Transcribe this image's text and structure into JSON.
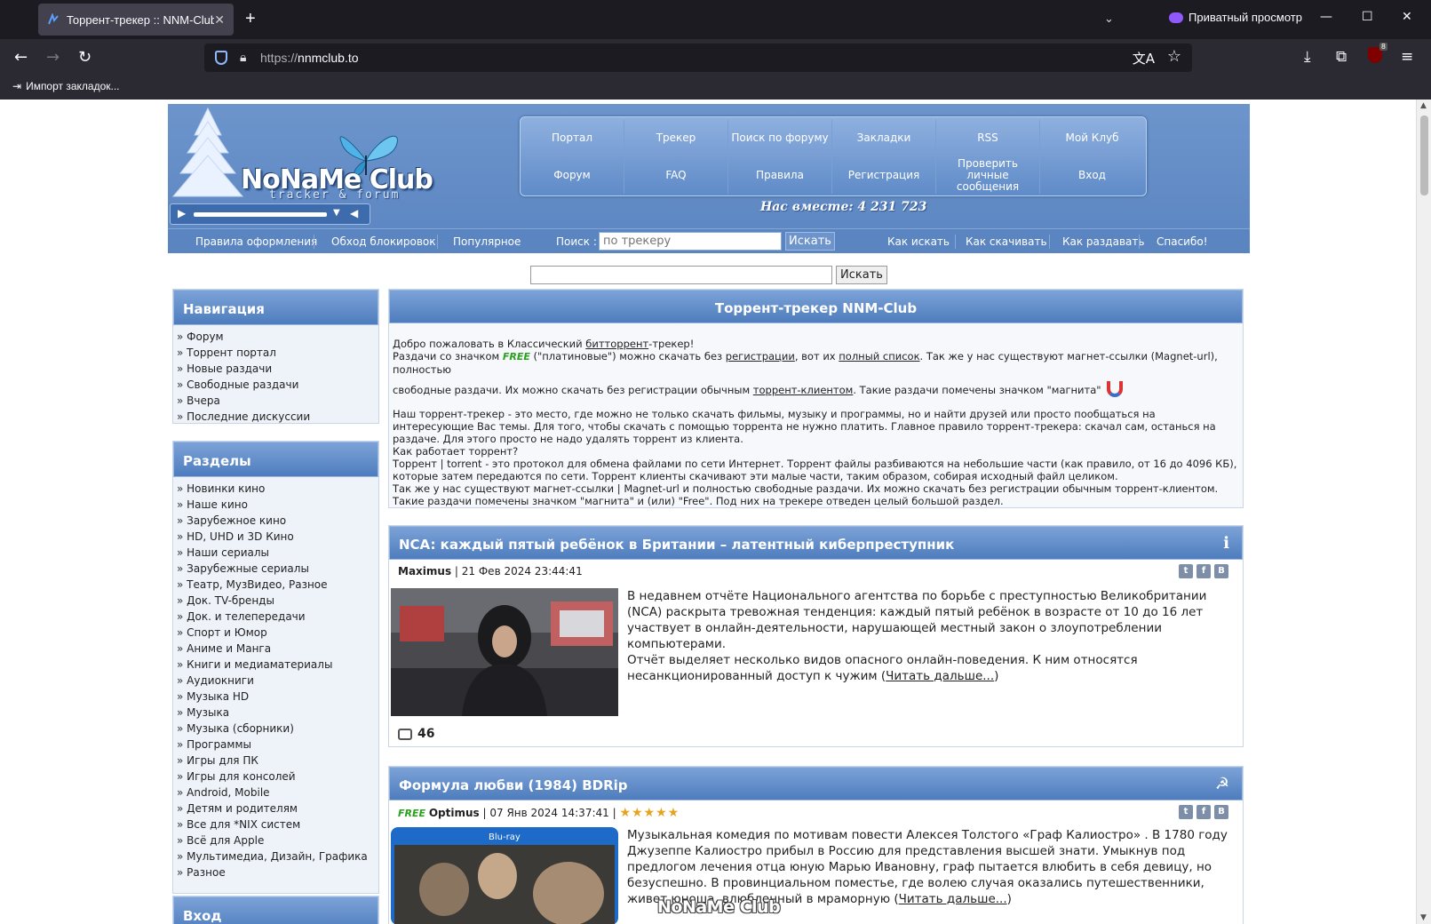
{
  "browser": {
    "tab_title": "Торрент-трекер :: NNM-Club",
    "new_tab": "+",
    "private_label": "Приватный просмотр",
    "url_proto": "https://",
    "url_host": "nnmclub.to",
    "bookmark": "Импорт закладок...",
    "ext_badge": "8"
  },
  "header": {
    "logo_text": "NoNaMe Club",
    "logo_sub": "tracker & forum",
    "together": "Нас вместе: 4 231 723",
    "nav_row1": [
      "Портал",
      "Трекер",
      "Поиск по форуму",
      "Закладки",
      "RSS",
      "Мой Клуб"
    ],
    "nav_row2": [
      "Форум",
      "FAQ",
      "Правила",
      "Регистрация",
      "Проверить личные сообщения",
      "Вход"
    ],
    "subbar_left": [
      "Правила оформления",
      "Обход блокировок",
      "Популярное"
    ],
    "search_label": "Поиск :",
    "search_placeholder": "по трекеру",
    "search_button": "Искать",
    "subbar_right": [
      "Как искать",
      "Как скачивать",
      "Как раздавать",
      "Спасибо!"
    ]
  },
  "search2": {
    "button": "Искать"
  },
  "sidebar": {
    "nav_title": "Навигация",
    "nav_items": [
      "Форум",
      "Торрент портал",
      "Новые раздачи",
      "Свободные раздачи",
      "Вчера",
      "Последние дискуссии"
    ],
    "sections_title": "Разделы",
    "sections_items": [
      "Новинки кино",
      "Наше кино",
      "Зарубежное кино",
      "HD, UHD и 3D Кино",
      "Наши сериалы",
      "Зарубежные сериалы",
      "Театр, МузВидео, Разное",
      "Док. TV-бренды",
      "Док. и телепередачи",
      "Спорт и Юмор",
      "Аниме и Манга",
      "Книги и медиаматериалы",
      "Аудиокниги",
      "Музыка HD",
      "Музыка",
      "Музыка (сборники)",
      "Программы",
      "Игры для ПК",
      "Игры для консолей",
      "Android, Mobile",
      "Детям и родителям",
      "Все для *NIX систем",
      "Всё для Apple",
      "Мультимедиа, Дизайн, Графика",
      "Разное"
    ],
    "login_title": "Вход"
  },
  "welcome": {
    "title": "Торрент-трекер NNM-Club",
    "l1a": "Добро пожаловать в Классический ",
    "l1link": "битторрент",
    "l1b": "-трекер!",
    "l2a": "Раздачи со значком ",
    "free": "FREE",
    "l2b": " (\"платиновые\") можно скачать без ",
    "l2link1": "регистрации",
    "l2c": ", вот их ",
    "l2link2": "полный список",
    "l2d": ". Так же у нас существуют магнет-ссылки (Magnet-url), полностью",
    "l3a": "свободные раздачи. Их можно скачать без регистрации обычным ",
    "l3link": "торрент-клиентом",
    "l3b": ". Такие раздачи помечены значком \"магнита\"",
    "p2": "Наш торрент-трекер - это место, где можно не только скачать фильмы, музыку и программы, но и найти друзей или просто пообщаться на интересующие Вас темы. Для того, чтобы скачать с помощью торрента не нужно платить. Главное правило торрент-трекера: скачал сам, останься на раздаче. Для этого просто не надо удалять торрент из клиента.",
    "p3": "Как работает торрент?",
    "p4": "Торрент | torrent - это протокол для обмена файлами по сети Интернет. Торрент файлы разбиваются на небольшие части (как правило, от 16 до 4096 КБ), которые затем передаются по сети. Торрент клиенты скачивают эти малые части, таким образом, собирая исходный файл целиком.",
    "p5": "Так же у нас существуют магнет-ссылки | Magnet-url и полностью свободные раздачи. Их можно скачать без регистрации обычным торрент-клиентом. Такие раздачи помечены значком \"магнита\" и (или) \"Free\". Под них на трекере отведен целый большой раздел."
  },
  "news1": {
    "title": "NCA: каждый пятый ребёнок в Британии – латентный киберпреступник",
    "icon": "info-icon",
    "author": "Maximus",
    "date": " | 21 Фев 2024 23:44:41",
    "text": "В недавнем отчёте Национального агентства по борьбе с преступностью Великобритании (NCA) раскрыта тревожная тенденция: каждый пятый ребёнок в возрасте от 10 до 16 лет участвует в онлайн-деятельности, нарушающей местный закон о злоупотреблении компьютерами.",
    "text2": "Отчёт выделяет несколько видов опасного онлайн-поведения. К ним относятся несанкционированный доступ к чужим (",
    "read_more": "Читать дальше...",
    "text2_end": ")",
    "comments": "46"
  },
  "news2": {
    "title": "Формула любви (1984) BDRip",
    "free": "FREE",
    "author": "Optimus",
    "date": " | 07 Янв 2024 14:37:41 | ",
    "rating": 5,
    "stars": "★★★★★",
    "text": "Музыкальная комедия по мотивам повести Алексея Толстого «Граф Калиостро» . В 1780 году Джузеппе Калиостро прибыл в Россию для представления высшей знати. Умыкнув под предлогом лечения отца юную Марью Ивановну, граф пытается влюбить в себя девицу, но безуспешно. В провинциальном поместье, где волею случая оказались путешественники, живет юноша, влюбленный в мраморную (",
    "read_more": "Читать дальше...",
    "text_end": ")"
  },
  "watermark": "NoNaMe Club",
  "colors": {
    "header_blue": "#5b85c1",
    "tab_bg": "#42414d",
    "free_green": "#28a21b"
  }
}
